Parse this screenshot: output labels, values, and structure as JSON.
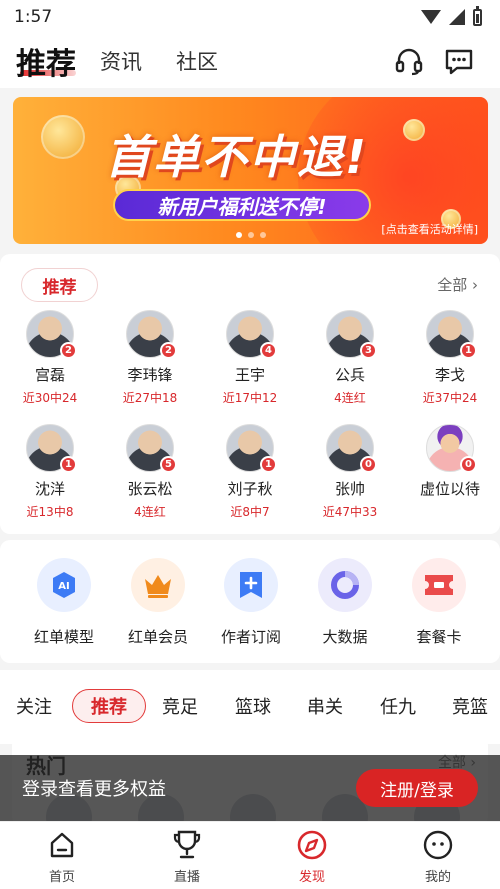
{
  "status_bar": {
    "time": "1:57"
  },
  "top_nav": {
    "tabs": [
      {
        "label": "推荐",
        "active": true
      },
      {
        "label": "资讯",
        "active": false
      },
      {
        "label": "社区",
        "active": false
      }
    ],
    "icons": [
      "headset-icon",
      "message-icon"
    ]
  },
  "banner": {
    "title": "首单不中退!",
    "subtitle": "新用户福利送不停!",
    "note": "[点击查看活动详情]",
    "slides": 3,
    "active_slide": 0
  },
  "experts": {
    "label": "推荐",
    "all_label": "全部",
    "items": [
      {
        "name": "宫磊",
        "stat": "近30中24",
        "badge": "2"
      },
      {
        "name": "李玮锋",
        "stat": "近27中18",
        "badge": "2"
      },
      {
        "name": "王宇",
        "stat": "近17中12",
        "badge": "4"
      },
      {
        "name": "公兵",
        "stat": "4连红",
        "badge": "3"
      },
      {
        "name": "李戈",
        "stat": "近37中24",
        "badge": "1"
      },
      {
        "name": "沈洋",
        "stat": "近13中8",
        "badge": "1"
      },
      {
        "name": "张云松",
        "stat": "4连红",
        "badge": "5"
      },
      {
        "name": "刘子秋",
        "stat": "近8中7",
        "badge": "1"
      },
      {
        "name": "张帅",
        "stat": "近47中33",
        "badge": "0"
      },
      {
        "name": "虚位以待",
        "stat": "",
        "badge": "0"
      }
    ]
  },
  "tools": [
    {
      "label": "红单模型",
      "icon": "ai-model-icon",
      "color": "#e8efff",
      "accent": "#3d7bf5"
    },
    {
      "label": "红单会员",
      "icon": "crown-icon",
      "color": "#fff0e3",
      "accent": "#f08a1c"
    },
    {
      "label": "作者订阅",
      "icon": "subscribe-icon",
      "color": "#e8efff",
      "accent": "#3d7bf5"
    },
    {
      "label": "大数据",
      "icon": "big-data-icon",
      "color": "#ecebfc",
      "accent": "#6a63e8"
    },
    {
      "label": "套餐卡",
      "icon": "ticket-icon",
      "color": "#ffeceb",
      "accent": "#ea4b4b"
    }
  ],
  "categories": [
    {
      "label": "关注",
      "active": false
    },
    {
      "label": "推荐",
      "active": true
    },
    {
      "label": "竞足",
      "active": false
    },
    {
      "label": "篮球",
      "active": false
    },
    {
      "label": "串关",
      "active": false
    },
    {
      "label": "任九",
      "active": false
    },
    {
      "label": "竞篮",
      "active": false
    }
  ],
  "hot": {
    "title": "热门",
    "all_label": "全部"
  },
  "login_bar": {
    "message": "登录查看更多权益",
    "button": "注册/登录"
  },
  "bottom_nav": [
    {
      "label": "首页",
      "icon": "home-icon",
      "active": false
    },
    {
      "label": "直播",
      "icon": "trophy-icon",
      "active": false
    },
    {
      "label": "发现",
      "icon": "compass-icon",
      "active": true
    },
    {
      "label": "我的",
      "icon": "profile-icon",
      "active": false
    }
  ],
  "colors": {
    "accent": "#d8282c",
    "banner_start": "#ffb13a",
    "banner_end": "#ff5a1a"
  }
}
